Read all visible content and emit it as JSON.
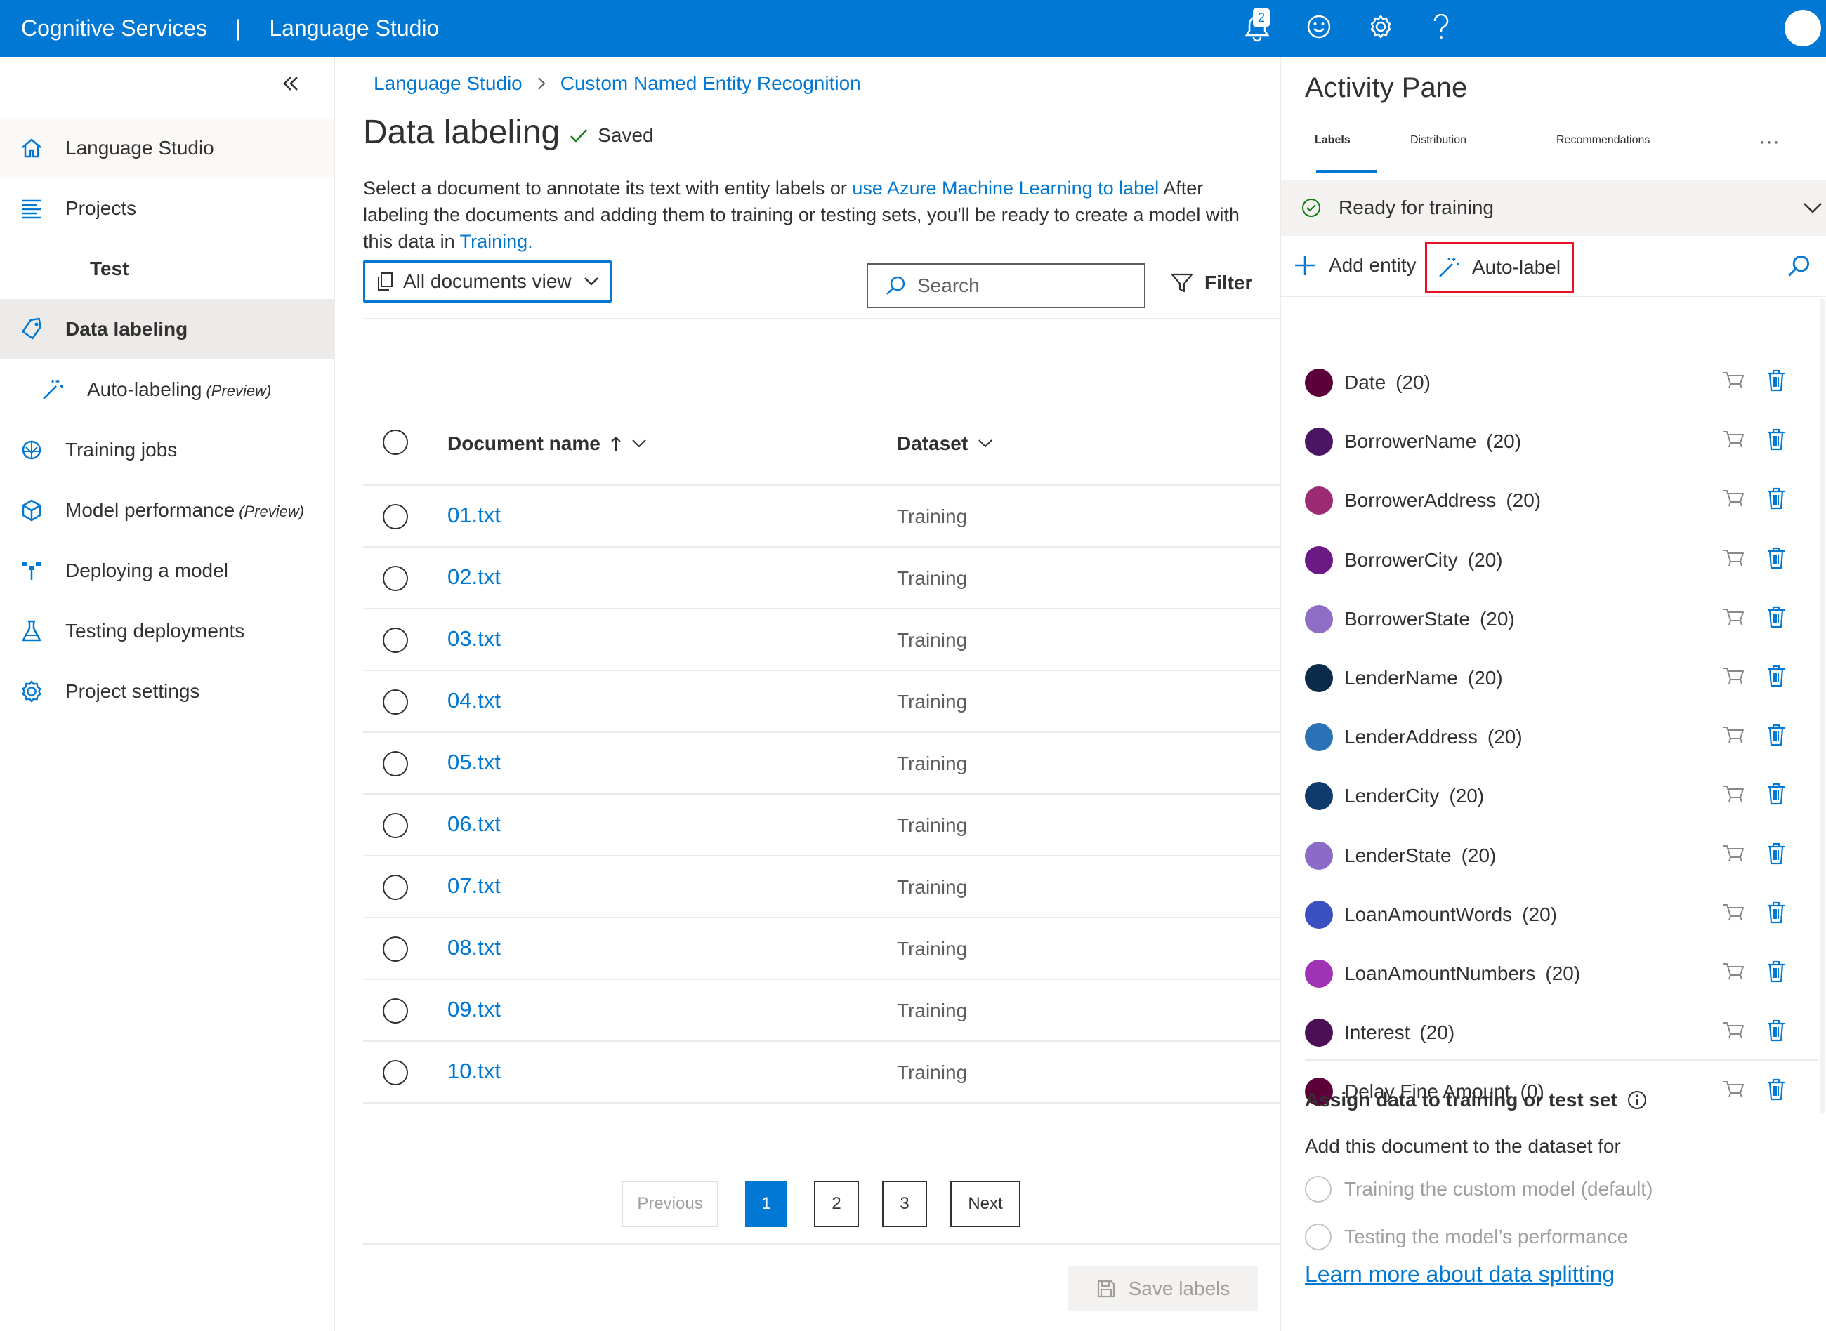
{
  "topbar": {
    "service": "Cognitive Services",
    "separator": "|",
    "product": "Language Studio",
    "notification_count": "2",
    "icons": [
      "bell-icon",
      "smiley-icon",
      "gear-icon",
      "help-icon",
      "avatar"
    ]
  },
  "sidebar": {
    "items": [
      {
        "label": "Language Studio",
        "icon": "home-icon"
      },
      {
        "label": "Projects",
        "icon": "list-icon"
      },
      {
        "label": "Test",
        "icon": ""
      },
      {
        "label": "Data labeling",
        "icon": "tag-icon"
      },
      {
        "label": "Auto-labeling",
        "suffix": "(Preview)",
        "icon": "magic-wand-icon"
      },
      {
        "label": "Training jobs",
        "icon": "brain-icon"
      },
      {
        "label": "Model performance",
        "suffix": "(Preview)",
        "icon": "cube-icon"
      },
      {
        "label": "Deploying a model",
        "icon": "deploy-icon"
      },
      {
        "label": "Testing deployments",
        "icon": "flask-icon"
      },
      {
        "label": "Project settings",
        "icon": "gear-icon"
      }
    ]
  },
  "main": {
    "breadcrumb": [
      "Language Studio",
      "Custom Named Entity Recognition"
    ],
    "title": "Data labeling",
    "saved": "Saved",
    "desc_1": "Select a document to annotate its text with entity labels or ",
    "desc_link_1": "use Azure Machine Learning to label",
    "desc_2": "  After labeling the documents and adding them to training or testing sets, you'll be ready to create a model with this data in ",
    "desc_link_2": "Training.",
    "view": "All documents view",
    "search_placeholder": "Search",
    "filter": "Filter",
    "columns": {
      "name": "Document name",
      "dataset": "Dataset"
    },
    "rows": [
      {
        "name": "01.txt",
        "dataset": "Training"
      },
      {
        "name": "02.txt",
        "dataset": "Training"
      },
      {
        "name": "03.txt",
        "dataset": "Training"
      },
      {
        "name": "04.txt",
        "dataset": "Training"
      },
      {
        "name": "05.txt",
        "dataset": "Training"
      },
      {
        "name": "06.txt",
        "dataset": "Training"
      },
      {
        "name": "07.txt",
        "dataset": "Training"
      },
      {
        "name": "08.txt",
        "dataset": "Training"
      },
      {
        "name": "09.txt",
        "dataset": "Training"
      },
      {
        "name": "10.txt",
        "dataset": "Training"
      }
    ],
    "pager": {
      "previous": "Previous",
      "pages": [
        "1",
        "2",
        "3"
      ],
      "current": "1",
      "next": "Next"
    },
    "save_labels": "Save labels"
  },
  "pane": {
    "title": "Activity Pane",
    "tabs": [
      "Labels",
      "Distribution",
      "Recommendations"
    ],
    "active_tab": "Labels",
    "more": "···",
    "status": "Ready for training",
    "add_entity": "Add entity",
    "auto_label": "Auto-label",
    "entities": [
      {
        "name": "Date",
        "count": "(20)",
        "color": "#5c0039"
      },
      {
        "name": "BorrowerName",
        "count": "(20)",
        "color": "#4b1563"
      },
      {
        "name": "BorrowerAddress",
        "count": "(20)",
        "color": "#9b2c73"
      },
      {
        "name": "BorrowerCity",
        "count": "(20)",
        "color": "#6b1a85"
      },
      {
        "name": "BorrowerState",
        "count": "(20)",
        "color": "#8f6dc4"
      },
      {
        "name": "LenderName",
        "count": "(20)",
        "color": "#0c2a4a"
      },
      {
        "name": "LenderAddress",
        "count": "(20)",
        "color": "#2a72b5"
      },
      {
        "name": "LenderCity",
        "count": "(20)",
        "color": "#0e3b6b"
      },
      {
        "name": "LenderState",
        "count": "(20)",
        "color": "#8c6bc8"
      },
      {
        "name": "LoanAmountWords",
        "count": "(20)",
        "color": "#3a4fc0"
      },
      {
        "name": "LoanAmountNumbers",
        "count": "(20)",
        "color": "#a032b5"
      },
      {
        "name": "Interest",
        "count": "(20)",
        "color": "#4a0f55"
      },
      {
        "name": "Delay Fine Amount",
        "count": "(0)",
        "color": "#5c0039"
      }
    ],
    "assign_title": "Assign data to training or test set",
    "assign_sub": "Add this document to the dataset for",
    "options": [
      "Training the custom model (default)",
      "Testing the model’s performance"
    ],
    "learn_more": "Learn more about data splitting"
  }
}
